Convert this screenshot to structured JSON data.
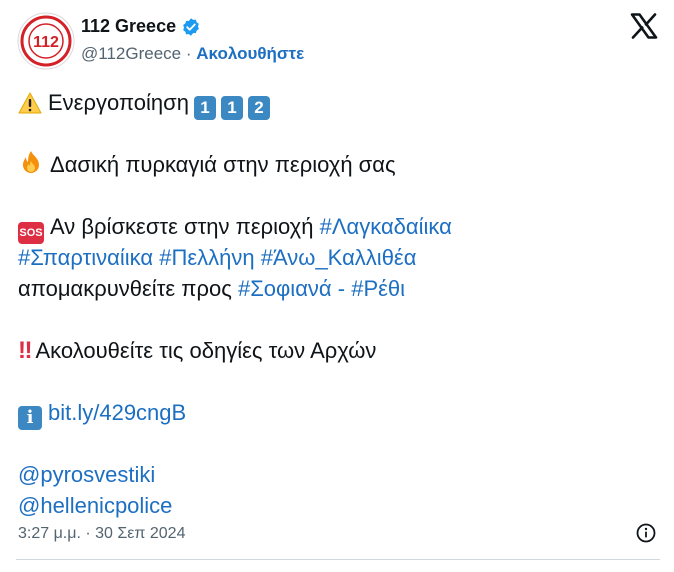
{
  "account": {
    "name": "112 Greece",
    "handle": "@112Greece",
    "separator": "·",
    "follow_label": "Ακολουθήστε",
    "avatar_text": "112",
    "verified_color": "#1d9bf0"
  },
  "tweet": {
    "line1_text": "Ενεργοποίηση",
    "line1_keys": [
      "1",
      "1",
      "2"
    ],
    "line2_text": "Δασική πυρκαγιά στην περιοχή σας",
    "sos_label": "SOS",
    "line3_text": "Αν βρίσκεστε στην περιοχή",
    "line3_tag": "#Λαγκαδαίικα",
    "line4_tags": [
      "#Σπαρτιναίικα",
      "#Πελλήνη",
      "#Άνω_Καλλιθέα"
    ],
    "line5_text": "απομακρυνθείτε προς",
    "line5_tag1": "#Σοφιανά",
    "line5_sep": "-",
    "line5_tag2": "#Ρέθι",
    "bang": "‼",
    "line6_text": "Ακολουθείτε τις οδηγίες των Αρχών",
    "info_glyph": "i",
    "link": "bit.ly/429cngB",
    "mentions": [
      "@pyrosvestiki",
      "@hellenicpolice"
    ]
  },
  "meta": {
    "timestamp": "3:27 μ.μ. · 30 Σεπ 2024"
  },
  "icons": {
    "warning": "warning-icon",
    "fire": "fire-icon",
    "platform": "x-logo-icon",
    "info": "info-circle-icon"
  },
  "colors": {
    "link": "#1d6fc2",
    "text": "#0f1419",
    "muted": "#536471",
    "keycap": "#3b88c3",
    "alert": "#dd2e44"
  }
}
